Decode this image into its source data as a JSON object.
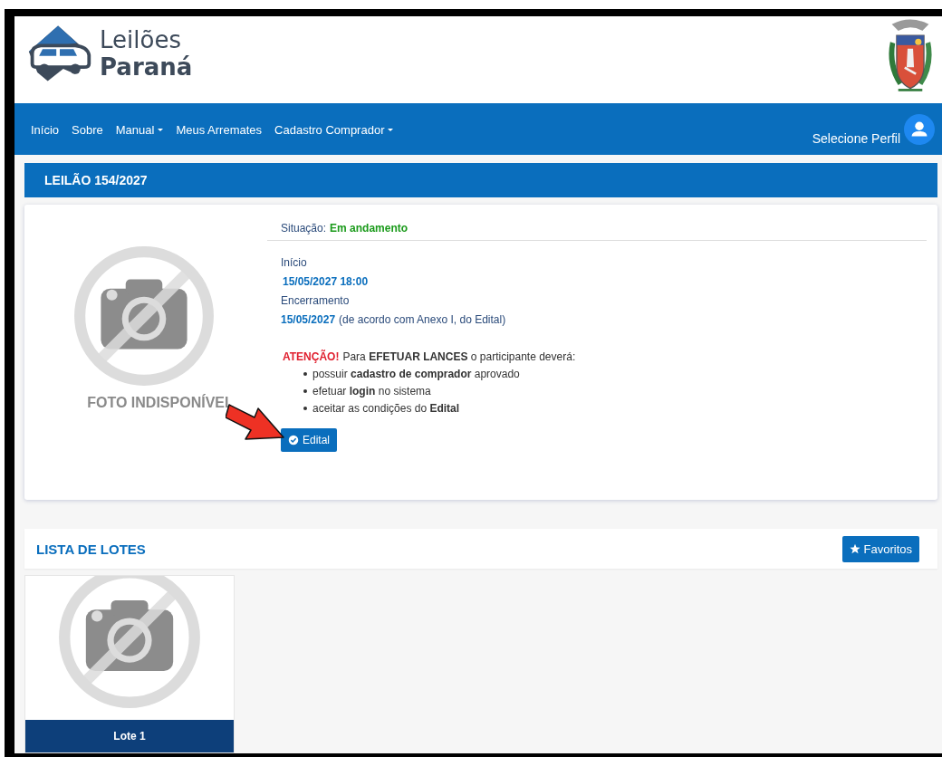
{
  "header": {
    "logo": {
      "line_1": "Leilões",
      "line_2": "Paraná"
    }
  },
  "nav": {
    "items": [
      {
        "label": "Início",
        "dropdown": false
      },
      {
        "label": "Sobre",
        "dropdown": false
      },
      {
        "label": "Manual",
        "dropdown": true
      },
      {
        "label": "Meus Arremates",
        "dropdown": false
      },
      {
        "label": "Cadastro Comprador",
        "dropdown": true
      }
    ],
    "profile": {
      "label": "Selecione Perfil"
    }
  },
  "auction": {
    "title": "LEILÃO 154/2027",
    "photo_caption": "FOTO INDISPONÍVEL",
    "status_label": "Situação:",
    "status": "Em andamento",
    "start_label": "Início",
    "start": "15/05/2027 18:00",
    "end_label": "Encerramento",
    "end": "15/05/2027",
    "end_note": "(de acordo com Anexo I, do Edital)",
    "warning_label": "ATENÇÃO!",
    "warning_text": "Para **EFETUAR LANCES** o participante deverá:",
    "requirements": [
      "possuir **cadastro de comprador** aprovado",
      "efetuar **login** no sistema",
      "aceitar as condições do **Edital**"
    ],
    "button": "Edital"
  },
  "lots": {
    "title": "LISTA DE LOTES",
    "favorites_button": "Favoritos",
    "items": [
      {
        "label": "Lote 1"
      }
    ]
  }
}
